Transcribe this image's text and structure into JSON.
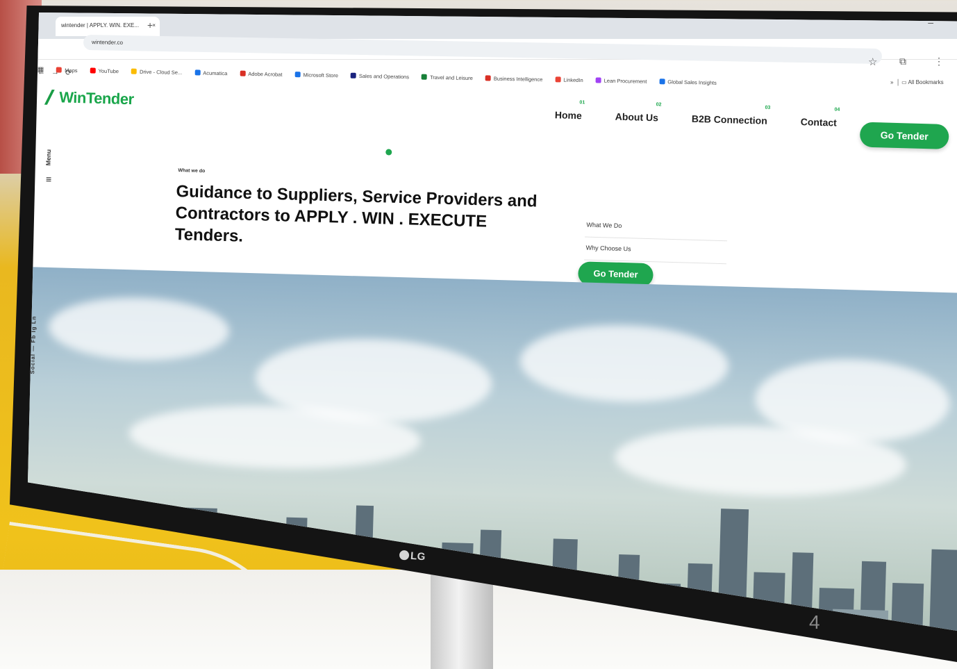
{
  "browser": {
    "tab_title": "wintender | APPLY. WIN. EXE...",
    "tab_close": "×",
    "new_tab": "+",
    "address": "wintender.co",
    "bookmarks": [
      "Maps",
      "YouTube",
      "Drive - Cloud Se...",
      "Acumatica",
      "Adobe Acrobat",
      "Microsoft Store",
      "Sales and Operations",
      "Travel and Leisure",
      "Business Intelligence",
      "LinkedIn",
      "Lean Procurement",
      "Global Sales Insights"
    ],
    "bookmarks_overflow": "»",
    "all_bookmarks": "All Bookmarks"
  },
  "site": {
    "logo": "WinTender",
    "nav": [
      {
        "num": "01",
        "label": "Home"
      },
      {
        "num": "02",
        "label": "About Us"
      },
      {
        "num": "03",
        "label": "B2B Connection"
      },
      {
        "num": "04",
        "label": "Contact"
      }
    ],
    "cta_top": "Go Tender",
    "menu_label": "Menu",
    "eyebrow": "What we do",
    "headline": "Guidance to Suppliers, Service Providers and Contractors to APPLY . WIN . EXECUTE Tenders.",
    "side_links": [
      "What We Do",
      "Why Choose Us"
    ],
    "cta_mid": "Go Tender",
    "social": "Social — Fb  Ig  Ln"
  },
  "monitor_brand": "LG",
  "slide_number": "4",
  "colors": {
    "brand_green": "#1fa64f",
    "wall": "#f0c21b"
  }
}
